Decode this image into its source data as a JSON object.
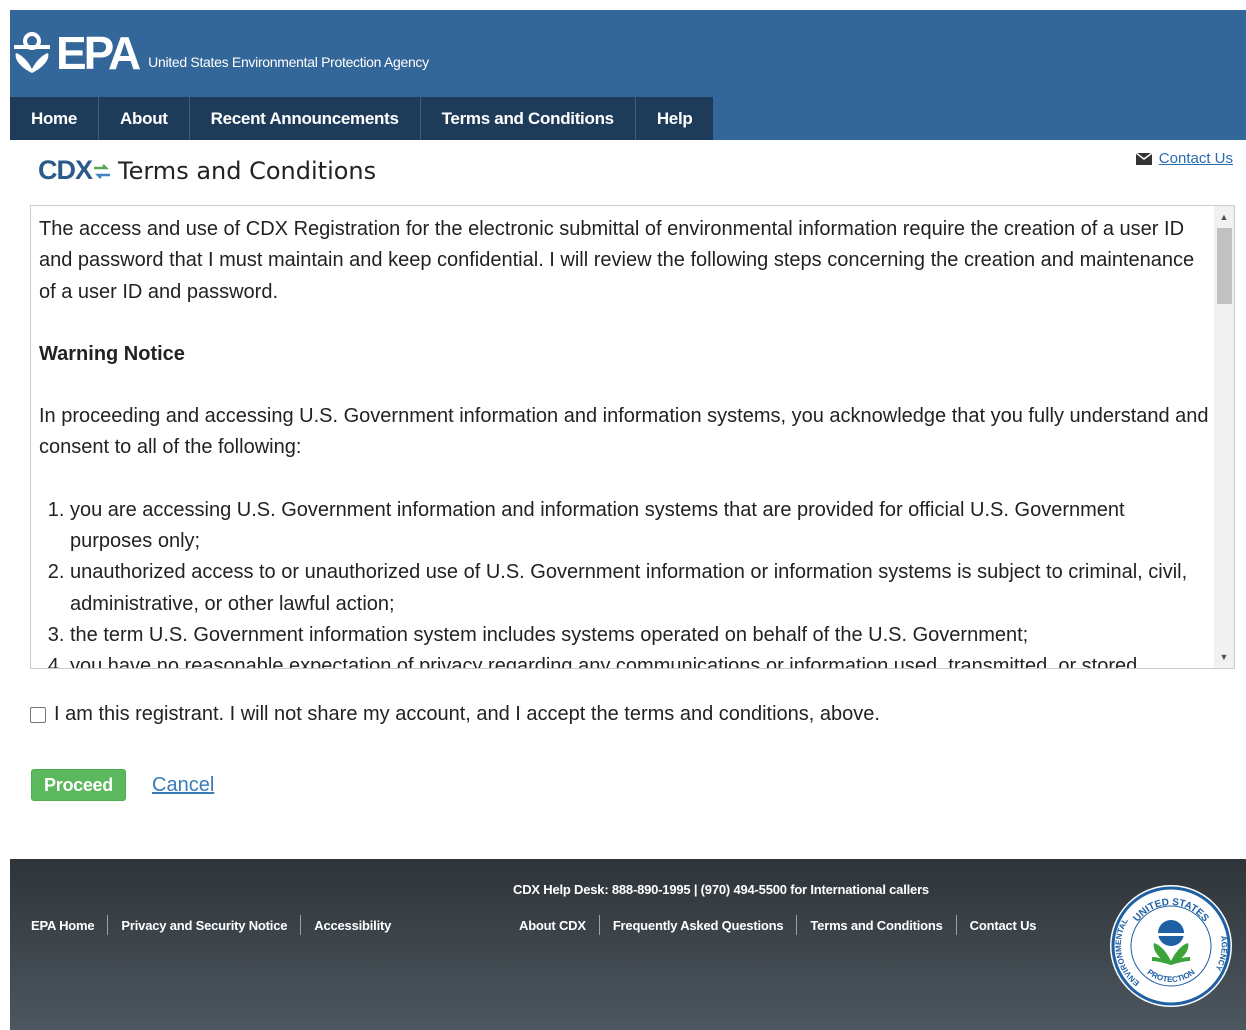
{
  "header": {
    "logo_text": "EPA",
    "agency_name": "United States Environmental Protection Agency",
    "nav": [
      "Home",
      "About",
      "Recent Announcements",
      "Terms and Conditions",
      "Help"
    ]
  },
  "page": {
    "logo_text": "CDX",
    "title": "Terms and Conditions",
    "contact_label": "Contact Us"
  },
  "terms": {
    "intro": "The access and use of CDX Registration for the electronic submittal of environmental information require the creation of a user ID and password that I must maintain and keep confidential. I will review the following steps concerning the creation and maintenance of a user ID and password.",
    "warning_heading": "Warning Notice",
    "consent_text": "In proceeding and accessing U.S. Government information and information systems, you acknowledge that you fully understand and consent to all of the following:",
    "items": [
      "you are accessing U.S. Government information and information systems that are provided for official U.S. Government purposes only;",
      "unauthorized access to or unauthorized use of U.S. Government information or information systems is subject to criminal, civil, administrative, or other lawful action;",
      "the term U.S. Government information system includes systems operated on behalf of the U.S. Government;",
      "you have no reasonable expectation of privacy regarding any communications or information used, transmitted, or stored"
    ]
  },
  "accept": {
    "label": "I am this registrant. I will not share my account, and I accept the terms and conditions, above.",
    "checked": false
  },
  "actions": {
    "proceed_label": "Proceed",
    "cancel_label": "Cancel"
  },
  "footer": {
    "left_links": [
      "EPA Home",
      "Privacy and Security Notice",
      "Accessibility"
    ],
    "helpdesk": "CDX Help Desk: 888-890-1995 | (970) 494-5500 for International callers",
    "mid_links": [
      "About CDX",
      "Frequently Asked Questions",
      "Terms and Conditions",
      "Contact Us"
    ],
    "seal_top_text": "UNITED STATES",
    "seal_left_text": "ENVIRONMENTAL",
    "seal_bottom_text": "PROTECTION",
    "seal_right_text": "AGENCY"
  },
  "colors": {
    "header_bg": "#336699",
    "nav_bg": "#1e3c5a",
    "proceed_green": "#5cb85c",
    "link_blue": "#3a7ab8"
  },
  "icons": [
    "epa-flower-icon",
    "cdx-arrows-icon",
    "envelope-icon",
    "scroll-up-arrow-icon",
    "scroll-down-arrow-icon",
    "epa-seal-icon"
  ]
}
